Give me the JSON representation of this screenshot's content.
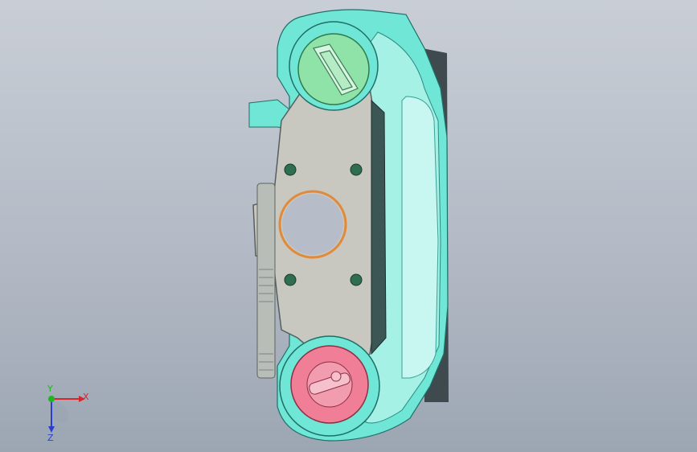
{
  "viewport": {
    "background_top": "#c9ced6",
    "background_bottom": "#9ca6b3"
  },
  "model": {
    "colors": {
      "housing_cyan": "#6fe6d6",
      "housing_light": "#b4f5ec",
      "bracket_gray": "#c8c7c0",
      "bracket_edge": "#55605e",
      "cap_green": "#8fe3a8",
      "cap_pink": "#ef7e96",
      "ring_orange": "#e08a3a",
      "hole_green": "#2f6e4e"
    }
  },
  "triad": {
    "x_label": "X",
    "y_label": "Y",
    "z_label": "Z",
    "x_color": "#d9242a",
    "y_color": "#1fb51f",
    "z_color": "#2a3fcf"
  }
}
